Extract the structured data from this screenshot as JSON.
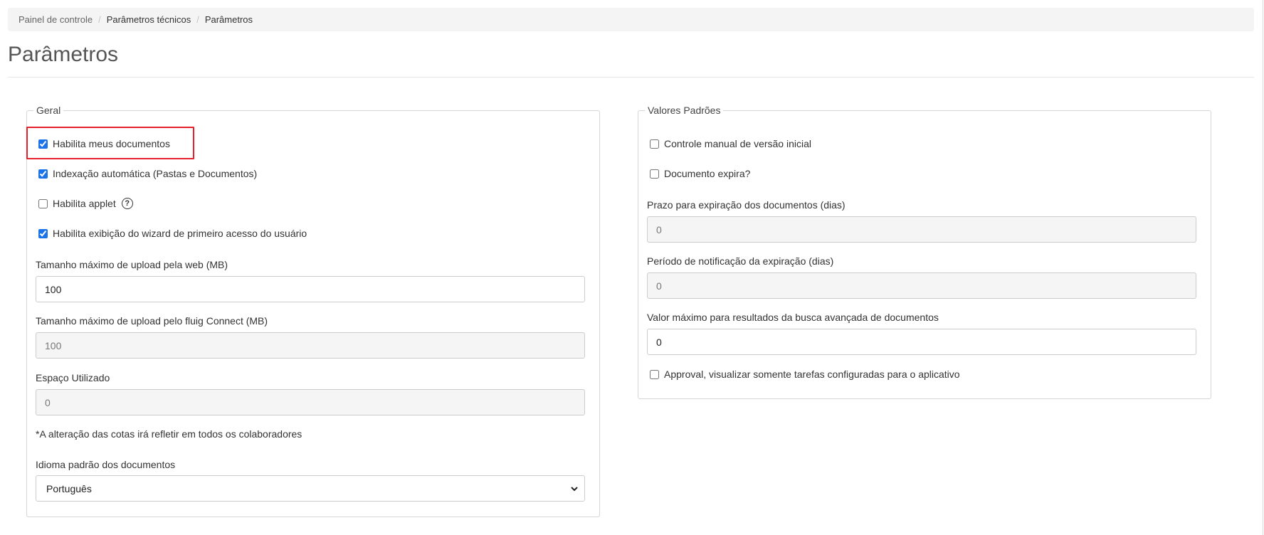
{
  "breadcrumb": {
    "items": [
      "Painel de controle",
      "Parâmetros técnicos",
      "Parâmetros"
    ],
    "separator": "/"
  },
  "page": {
    "title": "Parâmetros"
  },
  "geral": {
    "legend": "Geral",
    "checkboxes": [
      {
        "label": "Habilita meus documentos",
        "checked": true
      },
      {
        "label": "Indexação automática (Pastas e Documentos)",
        "checked": true
      },
      {
        "label": "Habilita applet",
        "checked": false
      },
      {
        "label": "Habilita exibição do wizard de primeiro acesso do usuário",
        "checked": true
      }
    ],
    "help_icon": "question-circle-icon",
    "help_glyph": "?",
    "upload_web": {
      "label": "Tamanho máximo de upload pela web (MB)",
      "value": "100"
    },
    "upload_connect": {
      "label": "Tamanho máximo de upload pelo fluig Connect (MB)",
      "value": "100"
    },
    "espaco": {
      "label": "Espaço Utilizado",
      "value": "0"
    },
    "note": "*A alteração das cotas irá refletir em todos os colaboradores",
    "idioma": {
      "label": "Idioma padrão dos documentos",
      "value": "Português"
    }
  },
  "valores": {
    "legend": "Valores Padrões",
    "controle_manual": {
      "label": "Controle manual de versão inicial",
      "checked": false
    },
    "doc_expira": {
      "label": "Documento expira?",
      "checked": false
    },
    "prazo": {
      "label": "Prazo para expiração dos documentos (dias)",
      "value": "0"
    },
    "periodo": {
      "label": "Período de notificação da expiração (dias)",
      "value": "0"
    },
    "valor_max": {
      "label": "Valor máximo para resultados da busca avançada de documentos",
      "value": "0"
    },
    "approval": {
      "label": "Approval, visualizar somente tarefas configuradas para o aplicativo",
      "checked": false
    }
  },
  "colors": {
    "highlight": "#e5202a",
    "checkbox_accent": "#1a73e8"
  }
}
